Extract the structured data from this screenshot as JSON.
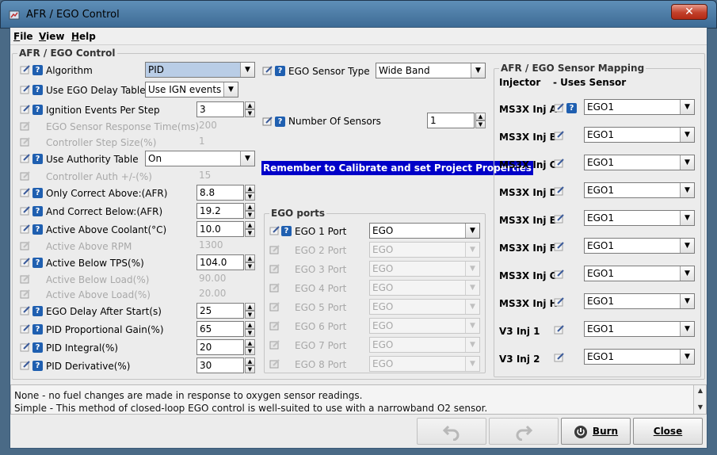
{
  "window": {
    "title": "AFR / EGO Control"
  },
  "menu": [
    "File",
    "View",
    "Help"
  ],
  "main_group": {
    "title": "AFR / EGO Control",
    "rows": [
      {
        "label": "Algorithm",
        "kind": "combo",
        "value": "PID",
        "enabled": true,
        "help": true
      },
      {
        "label": "Use EGO Delay Table",
        "kind": "combo",
        "value": "Use IGN events",
        "enabled": true,
        "help": true
      },
      {
        "label": "Ignition Events Per Step",
        "kind": "spin",
        "value": "3",
        "enabled": true,
        "help": true
      },
      {
        "label": "EGO Sensor Response Time(ms)",
        "kind": "spin",
        "value": "200",
        "enabled": false,
        "help": false
      },
      {
        "label": "Controller Step Size(%)",
        "kind": "spin",
        "value": "1",
        "enabled": false,
        "help": false
      },
      {
        "label": "Use Authority Table",
        "kind": "combo",
        "value": "On",
        "enabled": true,
        "help": true
      },
      {
        "label": "Controller Auth +/-(%)",
        "kind": "spin",
        "value": "15",
        "enabled": false,
        "help": false
      },
      {
        "label": "Only Correct Above:(AFR)",
        "kind": "spin",
        "value": "8.8",
        "enabled": true,
        "help": true
      },
      {
        "label": "And Correct Below:(AFR)",
        "kind": "spin",
        "value": "19.2",
        "enabled": true,
        "help": true
      },
      {
        "label": "Active Above Coolant(°C)",
        "kind": "spin",
        "value": "10.0",
        "enabled": true,
        "help": true
      },
      {
        "label": "Active Above RPM",
        "kind": "spin",
        "value": "1300",
        "enabled": false,
        "help": false
      },
      {
        "label": "Active Below TPS(%)",
        "kind": "spin",
        "value": "104.0",
        "enabled": true,
        "help": true
      },
      {
        "label": "Active Below Load(%)",
        "kind": "spin",
        "value": "90.00",
        "enabled": false,
        "help": false
      },
      {
        "label": "Active Above Load(%)",
        "kind": "spin",
        "value": "20.00",
        "enabled": false,
        "help": false
      },
      {
        "label": "EGO Delay After Start(s)",
        "kind": "spin",
        "value": "25",
        "enabled": true,
        "help": true
      },
      {
        "label": "PID Proportional Gain(%)",
        "kind": "spin",
        "value": "65",
        "enabled": true,
        "help": true
      },
      {
        "label": "PID Integral(%)",
        "kind": "spin",
        "value": "20",
        "enabled": true,
        "help": true
      },
      {
        "label": "PID Derivative(%)",
        "kind": "spin",
        "value": "30",
        "enabled": true,
        "help": true
      }
    ]
  },
  "sensor": {
    "type_label": "EGO Sensor Type",
    "type_value": "Wide Band",
    "count_label": "Number Of Sensors",
    "count_value": "1",
    "banner": "Remember to Calibrate and set Project Properties"
  },
  "ports": {
    "title": "EGO ports",
    "items": [
      {
        "label": "EGO 1 Port",
        "value": "EGO",
        "enabled": true
      },
      {
        "label": "EGO 2 Port",
        "value": "EGO",
        "enabled": false
      },
      {
        "label": "EGO 3 Port",
        "value": "EGO",
        "enabled": false
      },
      {
        "label": "EGO 4 Port",
        "value": "EGO",
        "enabled": false
      },
      {
        "label": "EGO 5 Port",
        "value": "EGO",
        "enabled": false
      },
      {
        "label": "EGO 6 Port",
        "value": "EGO",
        "enabled": false
      },
      {
        "label": "EGO 7 Port",
        "value": "EGO",
        "enabled": false
      },
      {
        "label": "EGO 8 Port",
        "value": "EGO",
        "enabled": false
      }
    ]
  },
  "mapping": {
    "title": "AFR / EGO Sensor Mapping",
    "col_injector": "Injector",
    "col_sensor": "- Uses Sensor",
    "items": [
      {
        "label": "MS3X Inj A",
        "value": "EGO1",
        "help": true
      },
      {
        "label": "MS3X Inj B",
        "value": "EGO1",
        "help": false
      },
      {
        "label": "MS3X Inj C",
        "value": "EGO1",
        "help": false
      },
      {
        "label": "MS3X Inj D",
        "value": "EGO1",
        "help": false
      },
      {
        "label": "MS3X Inj E",
        "value": "EGO1",
        "help": false
      },
      {
        "label": "MS3X Inj F",
        "value": "EGO1",
        "help": false
      },
      {
        "label": "MS3X Inj G",
        "value": "EGO1",
        "help": false
      },
      {
        "label": "MS3X Inj H",
        "value": "EGO1",
        "help": false
      },
      {
        "label": "V3 Inj 1",
        "value": "EGO1",
        "help": false
      },
      {
        "label": "V3 Inj 2",
        "value": "EGO1",
        "help": false
      }
    ]
  },
  "status": {
    "lines": [
      "None - no fuel changes are made in response to oxygen sensor readings.",
      "Simple - This method of closed-loop EGO control is well-suited to use with a narrowband O2 sensor."
    ]
  },
  "buttons": {
    "burn": "Burn",
    "close": "Close"
  },
  "icons": {
    "edit": "pencil-note-icon",
    "help": "question-icon",
    "undo": "undo-icon",
    "redo": "redo-icon",
    "burn": "power-icon"
  }
}
